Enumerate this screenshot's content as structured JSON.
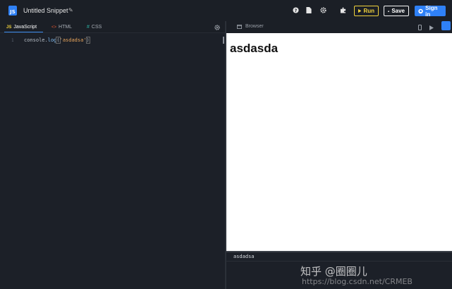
{
  "app": {
    "logo_text": "JS",
    "title": "Untitled Snippet"
  },
  "toolbar": {
    "icons": [
      "help-icon",
      "file-icon",
      "gear-icon",
      "puzzle-icon"
    ],
    "run_label": "Run",
    "save_label": "Save",
    "signin_label": "Sign in"
  },
  "editor": {
    "tabs": [
      {
        "icon": "JS",
        "label": "JavaScript",
        "active": true
      },
      {
        "icon": "<>",
        "label": "HTML",
        "active": false
      },
      {
        "icon": "#",
        "label": "CSS",
        "active": false
      }
    ],
    "line_number": "1",
    "code": {
      "obj": "console",
      "method": "log",
      "arg": "'asdadsa'"
    }
  },
  "browser": {
    "label": "Browser",
    "heading": "asdasda"
  },
  "console": {
    "output": "asdadsa"
  },
  "watermark": {
    "line1": "知乎 @圈圈儿",
    "line2": "https://blog.csdn.net/CRMEB"
  },
  "colors": {
    "accent_blue": "#2f81f7",
    "run_yellow": "#f1d23c",
    "bg": "#1c2028"
  }
}
